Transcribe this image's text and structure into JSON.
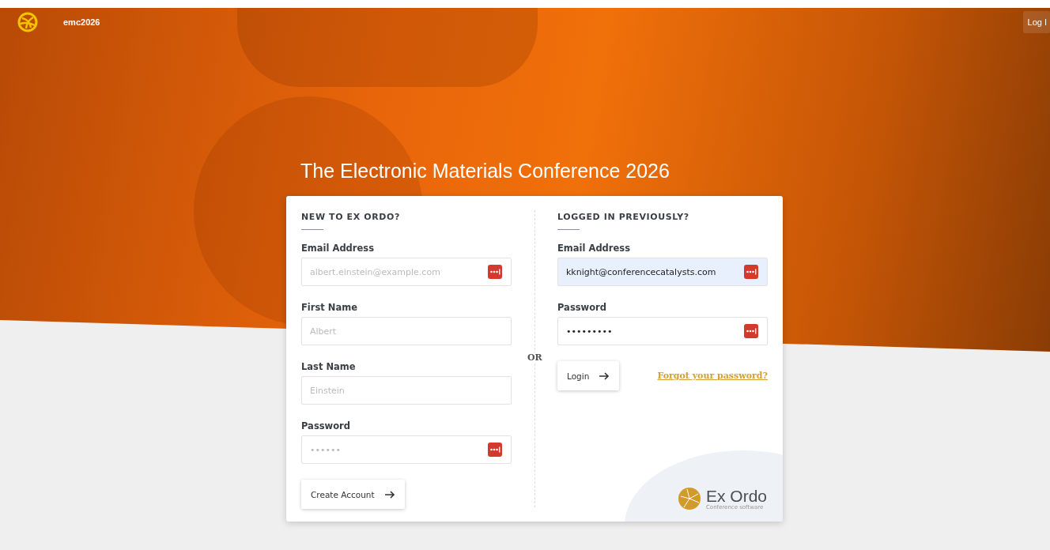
{
  "header": {
    "site_name": "emc2026",
    "login_button": "Log I"
  },
  "title": "The Electronic Materials Conference 2026",
  "new_account": {
    "heading": "NEW TO EX ORDO?",
    "fields": [
      {
        "label": "Email Address",
        "placeholder": "albert.einstein@example.com",
        "key_icon": true,
        "autofilled": false
      },
      {
        "label": "First Name",
        "placeholder": "Albert",
        "key_icon": false,
        "autofilled": false
      },
      {
        "label": "Last Name",
        "placeholder": "Einstein",
        "key_icon": false,
        "autofilled": false
      },
      {
        "label": "Password",
        "placeholder": "••••••",
        "key_icon": true,
        "autofilled": false
      }
    ],
    "button": "Create Account"
  },
  "divider_text": "OR",
  "login": {
    "heading": "LOGGED IN PREVIOUSLY?",
    "fields": [
      {
        "label": "Email Address",
        "value": "kknight@conferencecatalysts.com",
        "key_icon": true,
        "autofilled": true
      },
      {
        "label": "Password",
        "value": "•••••••••",
        "key_icon": true,
        "autofilled": false
      }
    ],
    "button": "Login",
    "forgot_link": "Forgot your password?"
  },
  "brand": {
    "name": "Ex Ordo",
    "tagline": "Conference software"
  }
}
